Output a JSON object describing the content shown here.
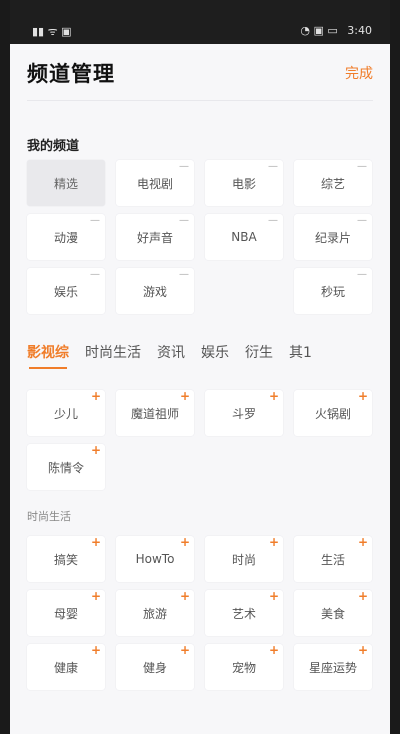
{
  "status_bar": {
    "left": "",
    "right_icons": "",
    "time": "3:40"
  },
  "header": {
    "title": "频道管理",
    "done_label": "完成"
  },
  "my_channels": {
    "title": "我的频道",
    "items": [
      {
        "label": "精选",
        "state": "selected"
      },
      {
        "label": "电视剧",
        "state": "removable"
      },
      {
        "label": "电影",
        "state": "removable"
      },
      {
        "label": "综艺",
        "state": "removable"
      },
      {
        "label": "动漫",
        "state": "removable"
      },
      {
        "label": "好声音",
        "state": "removable"
      },
      {
        "label": "NBA",
        "state": "removable"
      },
      {
        "label": "纪录片",
        "state": "removable"
      },
      {
        "label": "娱乐",
        "state": "removable"
      },
      {
        "label": "游戏",
        "state": "removable"
      },
      {
        "label": "",
        "state": "ghost"
      },
      {
        "label": "秒玩",
        "state": "removable"
      }
    ]
  },
  "category_tabs": [
    {
      "label": "影视综",
      "active": true
    },
    {
      "label": "时尚生活",
      "active": false
    },
    {
      "label": "资讯",
      "active": false
    },
    {
      "label": "娱乐",
      "active": false
    },
    {
      "label": "衍生",
      "active": false
    },
    {
      "label": "其1",
      "active": false
    }
  ],
  "ysz_channels": {
    "items": [
      "少儿",
      "魔道祖师",
      "斗罗",
      "火锅剧",
      "陈情令"
    ]
  },
  "fashion_life": {
    "title": "时尚生活",
    "items": [
      "搞笑",
      "HowTo",
      "时尚",
      "生活",
      "母婴",
      "旅游",
      "艺术",
      "美食",
      "健康",
      "健身",
      "宠物",
      "星座运势"
    ]
  },
  "icons": {
    "remove": "minus-icon",
    "add": "plus-icon"
  }
}
